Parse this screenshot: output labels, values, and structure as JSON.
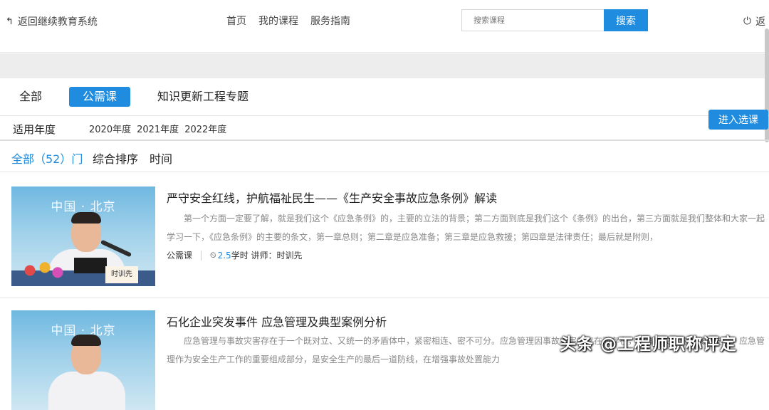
{
  "header": {
    "back_label": "返回继续教育系统",
    "nav": [
      "首页",
      "我的课程",
      "服务指南"
    ],
    "search_placeholder": "搜索课程",
    "search_button": "搜索",
    "logout_label": "返"
  },
  "categories": [
    "全部",
    "公需课",
    "知识更新工程专题"
  ],
  "active_category": "公需课",
  "years": {
    "label": "适用年度",
    "options": [
      "2020年度",
      "2021年度",
      "2022年度"
    ]
  },
  "sort": {
    "all_label": "全部（52）门",
    "option1": "综合排序",
    "option2": "时间"
  },
  "courses": [
    {
      "thumb_caption": "中国 · 北京",
      "nameplate": "时训先",
      "title": "严守安全红线，护航福祉民生——《生产安全事故应急条例》解读",
      "desc": "第一个方面一定要了解，就是我们这个《应急条例》的，主要的立法的背景；第二方面到底是我们这个《条例》的出台，第三方面就是我们整体和大家一起学习一下，《应急条例》的主要的条文，第一章总则；第二章是应急准备；第三章是应急救援；第四章是法律责任；最后就是附则，",
      "type": "公需课",
      "hours": "2.5",
      "hours_suffix": "学时 讲师：时训先",
      "enter_label": "进入选课"
    },
    {
      "thumb_caption": "中国 · 北京",
      "title": "石化企业突发事件 应急管理及典型案例分析",
      "desc": "应急管理与事故灾害存在于一个既对立、又统一的矛盾体中，紧密相连、密不可分。应急管理因事故灾害的存在而存在，因事故灾害的发展而发展，应急管理作为安全生产工作的重要组成部分，是安全生产的最后一道防线，在增强事故处置能力"
    }
  ],
  "watermark": "头条 @工程师职称评定"
}
